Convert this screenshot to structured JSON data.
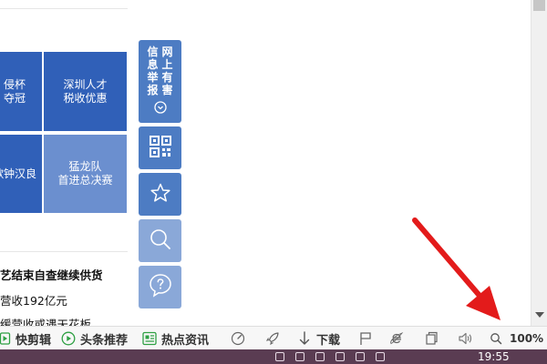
{
  "tiles": [
    {
      "line1": "侵杯",
      "line2": "夺冠",
      "color": "#3060b8"
    },
    {
      "line1": "深圳人才",
      "line2": "税收优惠",
      "color": "#3060b8"
    },
    {
      "line1": "歌钟汉良",
      "line2": "",
      "color": "#3060b8"
    },
    {
      "line1": "猛龙队",
      "line2": "首进总决赛",
      "color": "#6b8fcf"
    }
  ],
  "news": [
    "艺结束自查继续供货",
    "营收192亿元",
    "缓营收或遇天花板"
  ],
  "side_toolbar": {
    "report_text": [
      "网",
      "上",
      "有",
      "害",
      "信",
      "息",
      "举",
      "报"
    ],
    "buttons": [
      "chevron-down-circle-icon",
      "qr-code-icon",
      "star-icon",
      "search-icon",
      "help-icon"
    ],
    "color": "#4d7cc3"
  },
  "statusbar": {
    "clip": "快剪辑",
    "headline": "头条推荐",
    "hot_news": "热点资讯",
    "download": "下载",
    "zoom": "100%"
  },
  "taskbar": {
    "time": "19:55"
  },
  "accent_colors": {
    "arrow": "#e31b1b",
    "status_green": "#2ea043"
  }
}
